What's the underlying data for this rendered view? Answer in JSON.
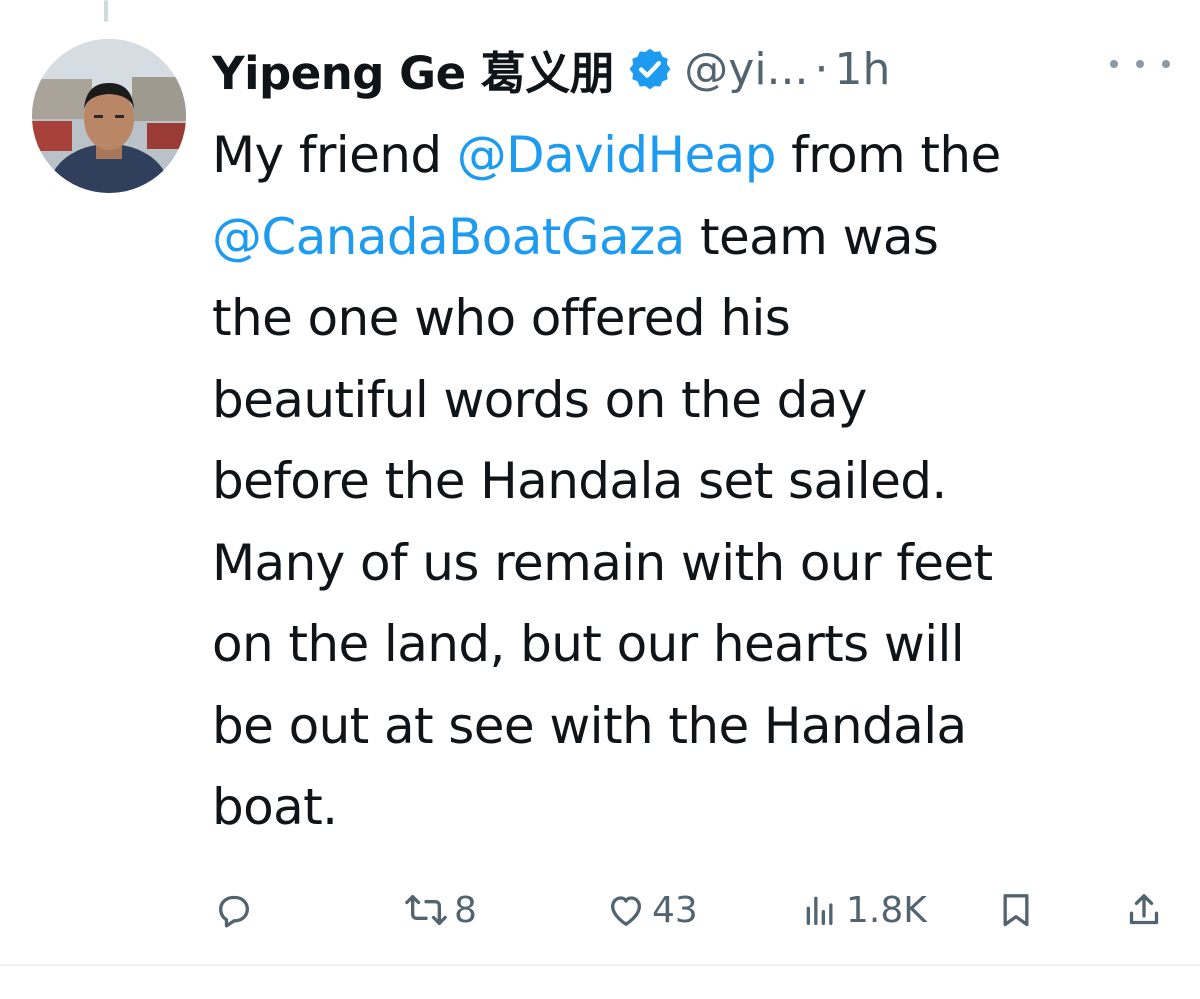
{
  "tweet": {
    "author_name": "Yipeng Ge 葛义朋",
    "handle": "@yi...",
    "separator": "·",
    "time": "1h",
    "text": {
      "l1_pre": "My friend ",
      "l1_mention": "@DavidHeap",
      "l1_post": " from the",
      "l2_mention": "@CanadaBoatGaza",
      "l2_post": " team was",
      "l3": "the one who offered his",
      "l4": "beautiful words on the day",
      "l5": "before the Handala set sailed.",
      "l6": "Many of us remain with our feet",
      "l7": "on the land, but our hearts will",
      "l8": "be out at see with the Handala",
      "l9": "boat."
    }
  },
  "metrics": {
    "retweets": "8",
    "likes": "43",
    "views": "1.8K"
  },
  "colors": {
    "accent": "#1d9bf0",
    "text": "#0f1419",
    "secondary": "#536471"
  },
  "icons": {
    "reply": "reply-icon",
    "retweet": "retweet-icon",
    "like": "heart-icon",
    "views": "views-icon",
    "bookmark": "bookmark-icon",
    "share": "share-icon",
    "more": "more-icon",
    "verified": "verified-badge-icon"
  }
}
